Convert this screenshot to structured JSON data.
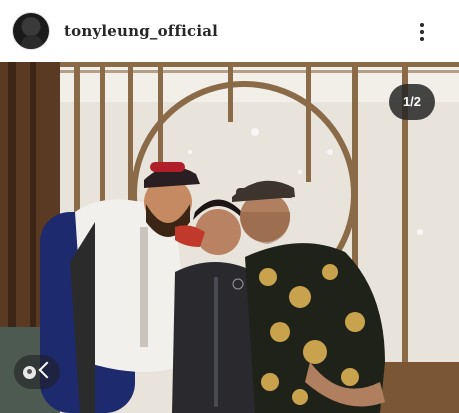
{
  "post": {
    "username": "tonyleung_official",
    "counter": "1/2"
  },
  "icons": {
    "avatar": "profile-avatar",
    "more": "more-options-icon",
    "prev": "chevron-left-icon",
    "tag": "user-tag-icon"
  },
  "colors": {
    "text": "#262626",
    "counter_bg": "#262626"
  }
}
